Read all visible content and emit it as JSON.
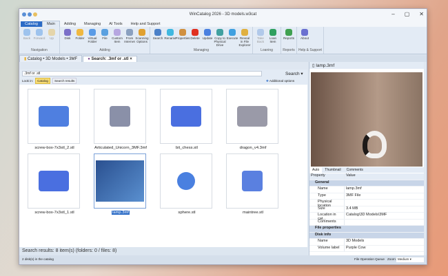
{
  "window": {
    "title": "WinCatalog 2026 - 3D models.w3cat"
  },
  "ribbon_tabs": [
    "Catalog",
    "Main",
    "Adding",
    "Managing",
    "AI Tools",
    "Help and Support"
  ],
  "groups": [
    {
      "label": "Navigation",
      "buttons": [
        {
          "label": "Back",
          "color": "#5a9be6",
          "disabled": true
        },
        {
          "label": "Forward",
          "color": "#5a9be6",
          "disabled": true
        },
        {
          "label": "Up",
          "color": "#e8c060",
          "disabled": true
        }
      ]
    },
    {
      "label": "Adding",
      "buttons": [
        {
          "label": "Disk",
          "color": "#7a6fc8"
        },
        {
          "label": "Folder",
          "color": "#f0b840"
        },
        {
          "label": "Virtual Folder",
          "color": "#5a9be6"
        },
        {
          "label": "File",
          "color": "#5aa0e0"
        },
        {
          "label": "Custom Item",
          "color": "#b6a6e0"
        },
        {
          "label": "From Internet",
          "color": "#8aa0c0"
        },
        {
          "label": "Scanning Options",
          "color": "#e0a030"
        }
      ]
    },
    {
      "label": "Managing",
      "buttons": [
        {
          "label": "Search",
          "color": "#4a80c8"
        },
        {
          "label": "Rename",
          "color": "#40b8e0"
        },
        {
          "label": "Properties",
          "color": "#d09040"
        },
        {
          "label": "Delete",
          "color": "#e03020"
        },
        {
          "label": "Update",
          "color": "#4a80e0"
        },
        {
          "label": "Copy to Physical Drive",
          "color": "#40a0a0"
        },
        {
          "label": "Execute",
          "color": "#40a0e0"
        },
        {
          "label": "Reveal in File Explorer",
          "color": "#e0b040"
        }
      ]
    },
    {
      "label": "Loaning",
      "buttons": [
        {
          "label": "Take Back",
          "color": "#80a8e0",
          "disabled": true
        },
        {
          "label": "Loan Item",
          "color": "#30a060"
        }
      ]
    },
    {
      "label": "Reports",
      "buttons": [
        {
          "label": "Reports",
          "color": "#40a050"
        }
      ]
    },
    {
      "label": "Help & Support",
      "buttons": [
        {
          "label": "About",
          "color": "#6a70d0"
        }
      ]
    }
  ],
  "doc_tabs": [
    "Catalog • 3D Models • 3MF",
    "Search: .3mf or .stl"
  ],
  "search": {
    "query": ".3mf or .stl",
    "button": "Search",
    "look_in": "Look in:",
    "catalog": "Catalog",
    "results": "Search results",
    "additional": "Additional options"
  },
  "items": [
    {
      "name": "screw-box-7x3stl_2.stl"
    },
    {
      "name": "Articulated_Unicorn_3MF.3mf"
    },
    {
      "name": "bit_chess.stl"
    },
    {
      "name": "dragon_v4.3mf"
    },
    {
      "name": "screw-box-7x3stl_1.stl"
    },
    {
      "name": "lamp.3mf",
      "selected": true
    },
    {
      "name": "sphere.stl"
    },
    {
      "name": "maintree.stl"
    }
  ],
  "results_text": "Search results: 8 item(s) (folders: 0 / files: 8)",
  "preview": {
    "file": "lamp.3mf",
    "tabs": [
      "Auto",
      "Thumbnail",
      "Comments"
    ]
  },
  "props": {
    "header": [
      "Property",
      "Value"
    ],
    "rows": [
      {
        "type": "h",
        "k": "General"
      },
      {
        "k": "Name",
        "v": "lamp.3mf"
      },
      {
        "k": "Type",
        "v": "3MF File"
      },
      {
        "k": "Physical location",
        "v": ""
      },
      {
        "k": "Size",
        "v": "3.4 MB"
      },
      {
        "k": "Location in cat...",
        "v": "Catalog\\3D Models\\3MF"
      },
      {
        "k": "Comments",
        "v": ""
      },
      {
        "type": "h",
        "k": "File properties"
      },
      {
        "type": "h",
        "k": "Disk info"
      },
      {
        "k": "Name",
        "v": "3D Models"
      },
      {
        "k": "Volume label",
        "v": "Purple Cow"
      }
    ]
  },
  "status": {
    "left": "2 disk(s) in the catalog",
    "queue": "File Operation Queue",
    "zoom_label": "Zoom:",
    "zoom": "Medium"
  }
}
